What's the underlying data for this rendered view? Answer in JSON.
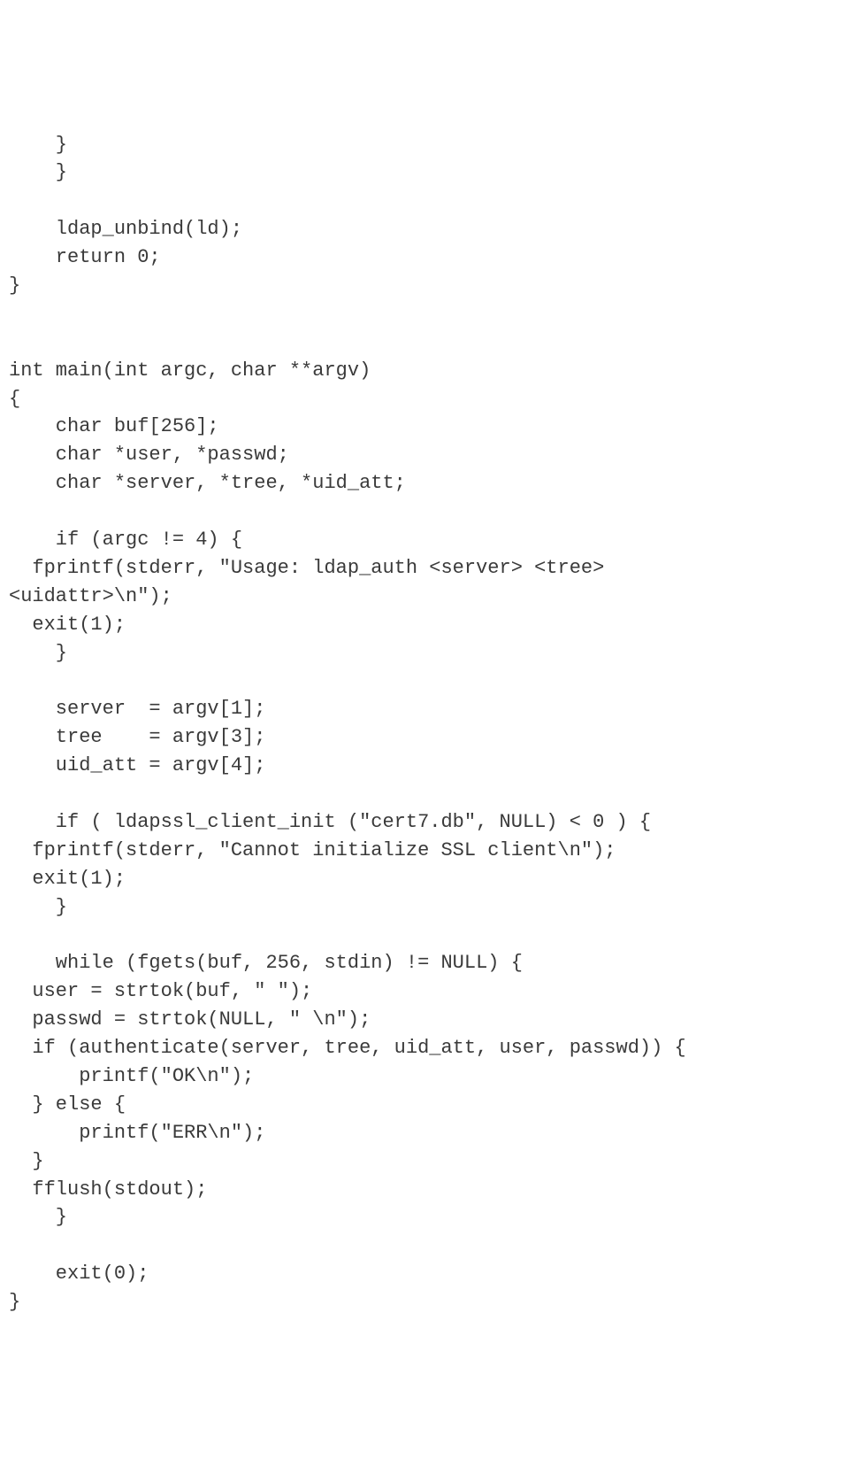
{
  "code": {
    "lines": [
      "    }",
      "    }",
      "",
      "    ldap_unbind(ld);",
      "    return 0;",
      "}",
      "",
      "",
      "int main(int argc, char **argv)",
      "{",
      "    char buf[256];",
      "    char *user, *passwd;",
      "    char *server, *tree, *uid_att;",
      "",
      "    if (argc != 4) {",
      "  fprintf(stderr, \"Usage: ldap_auth <server> <tree>",
      "<uidattr>\\n\");",
      "  exit(1);",
      "    }",
      "",
      "    server  = argv[1];",
      "    tree    = argv[3];",
      "    uid_att = argv[4];",
      "",
      "    if ( ldapssl_client_init (\"cert7.db\", NULL) < 0 ) {",
      "  fprintf(stderr, \"Cannot initialize SSL client\\n\");",
      "  exit(1);",
      "    }",
      "",
      "    while (fgets(buf, 256, stdin) != NULL) {",
      "  user = strtok(buf, \" \");",
      "  passwd = strtok(NULL, \" \\n\");",
      "  if (authenticate(server, tree, uid_att, user, passwd)) {",
      "      printf(\"OK\\n\");",
      "  } else {",
      "      printf(\"ERR\\n\");",
      "  }",
      "  fflush(stdout);",
      "    }",
      "",
      "    exit(0);",
      "}"
    ]
  }
}
